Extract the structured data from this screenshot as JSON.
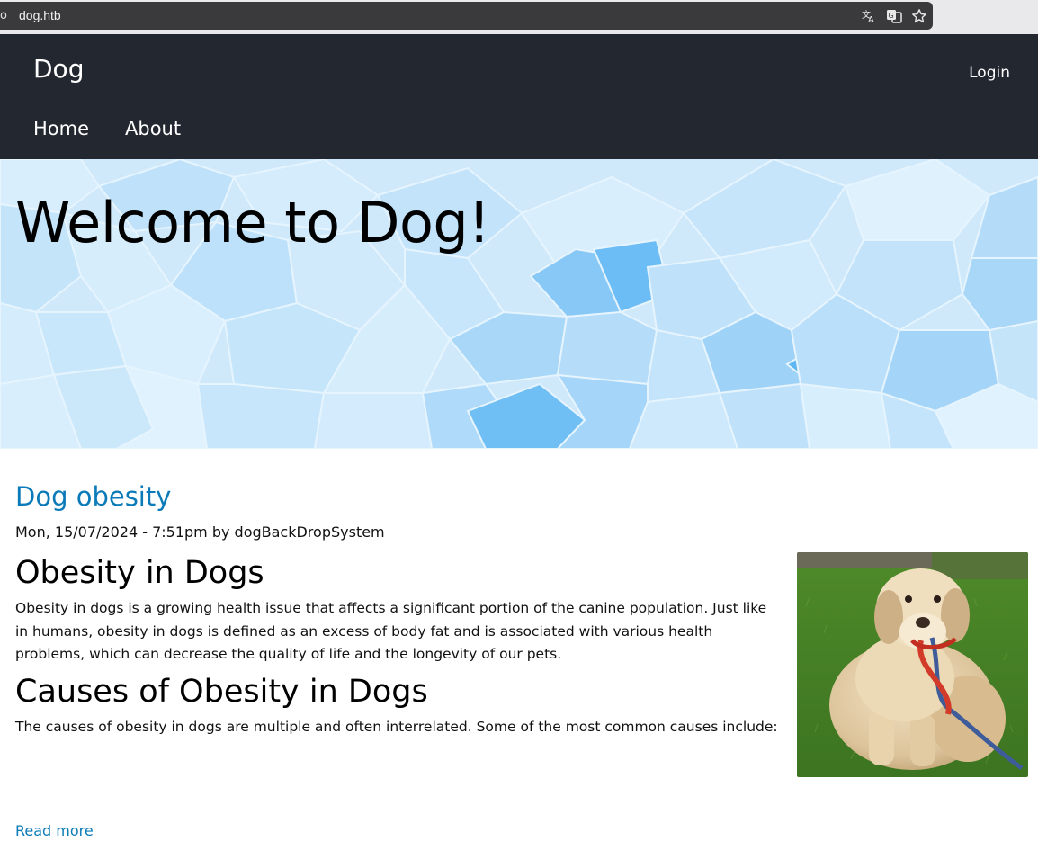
{
  "browser": {
    "url": "dog.htb",
    "icons": [
      "translate-icon",
      "reader-translate-icon",
      "bookmark-star-icon"
    ]
  },
  "header": {
    "site_name": "Dog",
    "login_label": "Login",
    "nav": [
      {
        "label": "Home"
      },
      {
        "label": "About"
      }
    ],
    "background": "#232730"
  },
  "hero": {
    "title": "Welcome to Dog!"
  },
  "article": {
    "title": "Dog obesity",
    "meta": "Mon, 15/07/2024 - 7:51pm by dogBackDropSystem",
    "heading1": "Obesity in Dogs",
    "paragraph1": "Obesity in dogs is a growing health issue that affects a significant portion of the canine population. Just like in humans, obesity in dogs is defined as an excess of body fat and is associated with various health problems, which can decrease the quality of life and the longevity of our pets.",
    "heading2": "Causes of Obesity in Dogs",
    "paragraph2": "The causes of obesity in dogs are multiple and often interrelated. Some of the most common causes include:",
    "read_more": "Read more",
    "link_color": "#0b7ab8"
  }
}
